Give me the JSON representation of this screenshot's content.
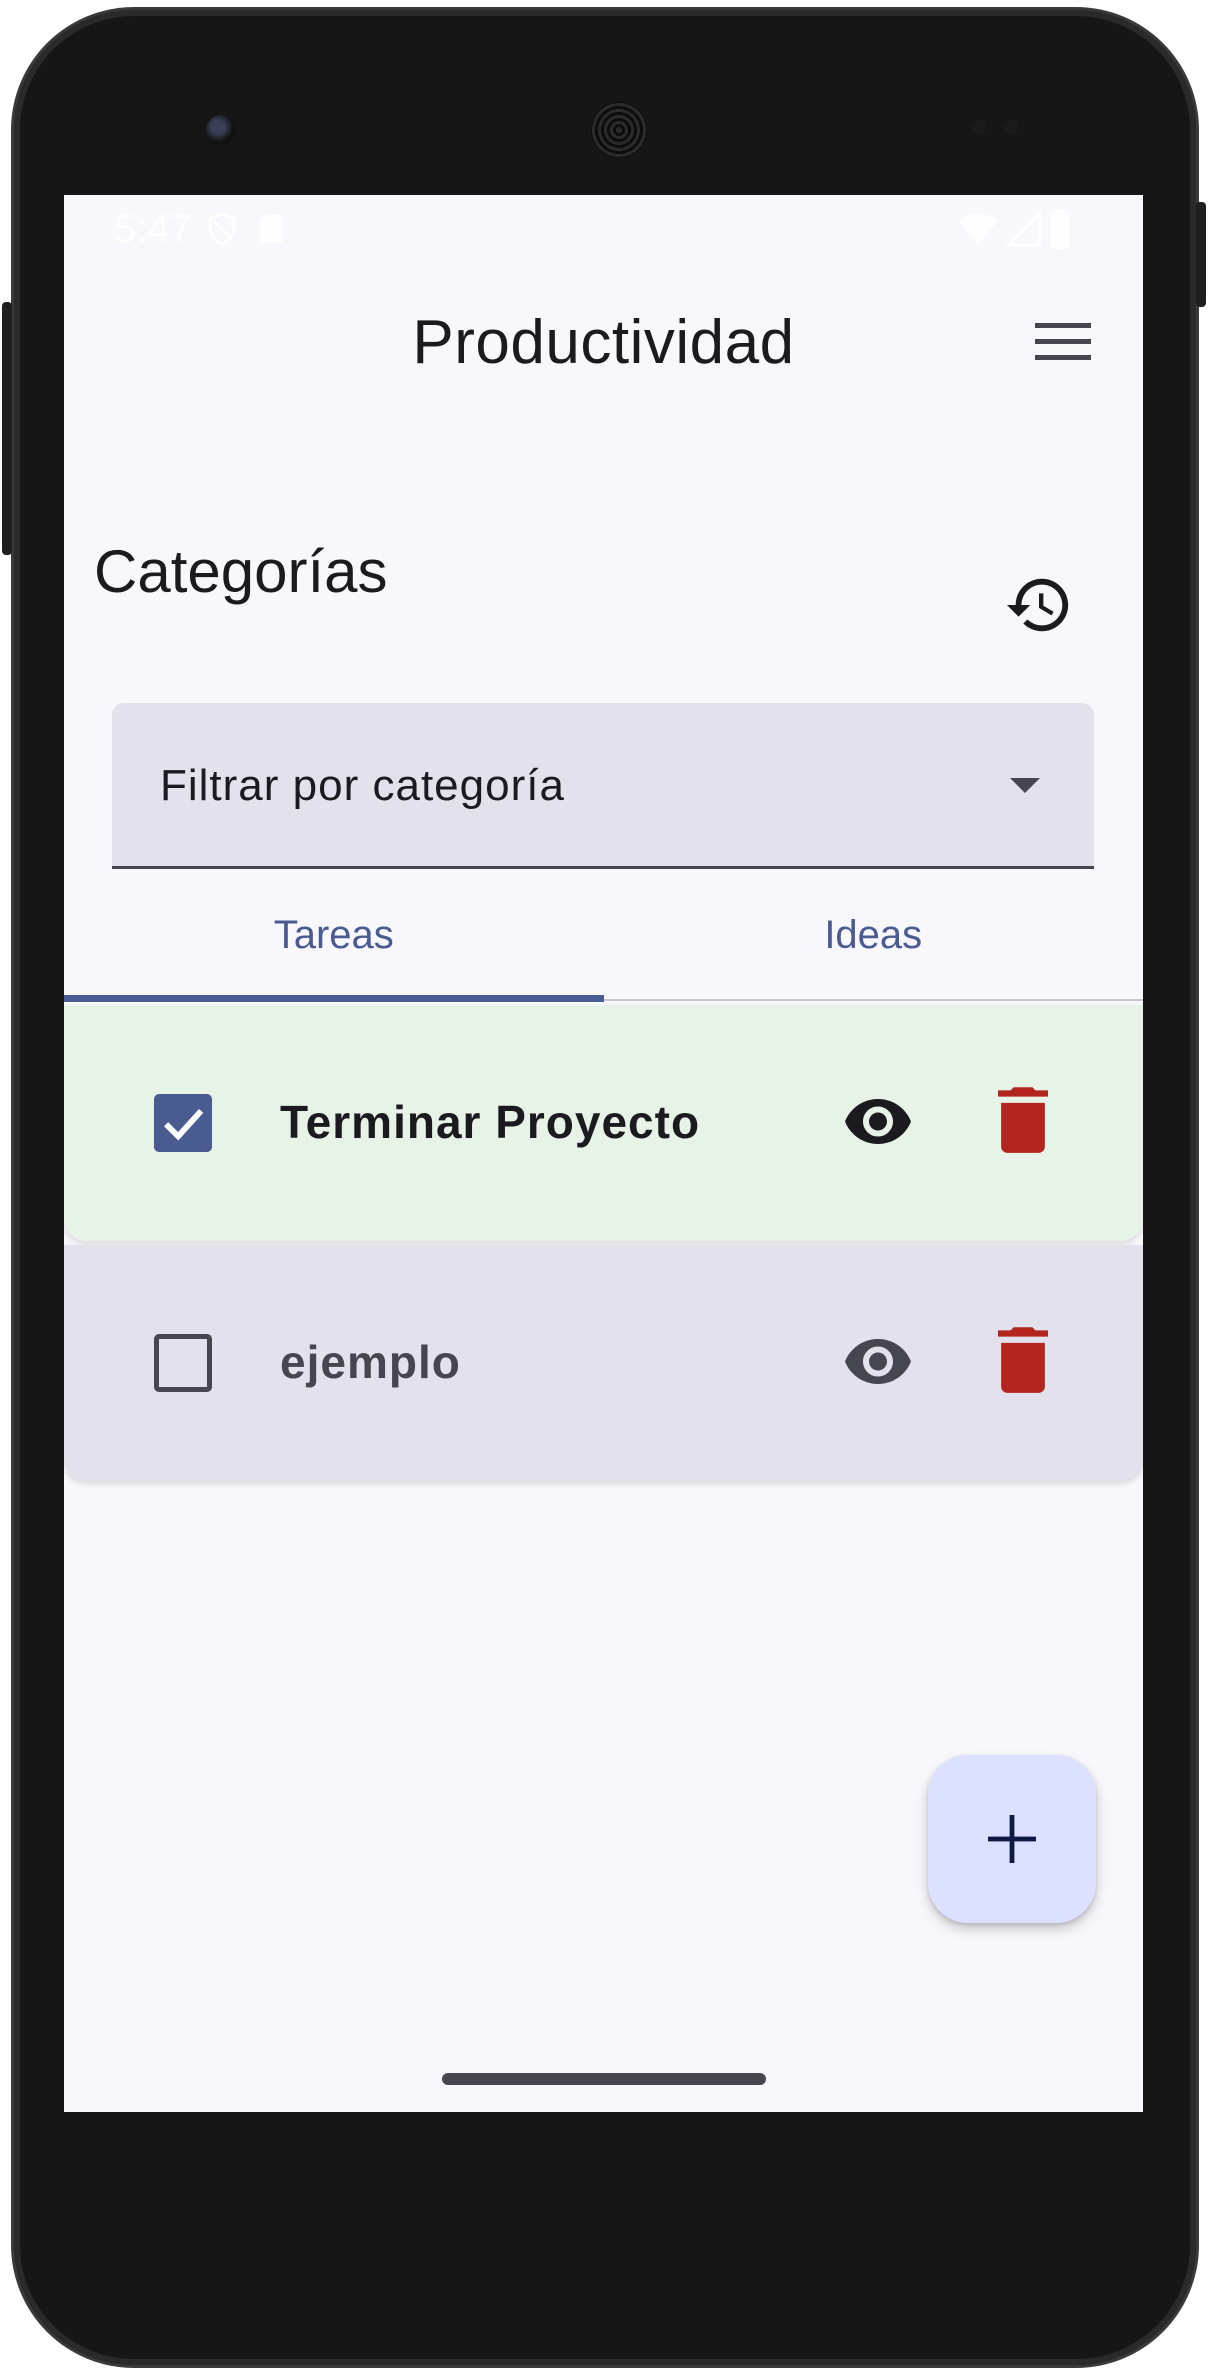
{
  "status_bar": {
    "time": "5:47",
    "left_icons": [
      "shield-icon",
      "sd-card-icon"
    ],
    "right_icons": [
      "wifi-icon",
      "signal-icon",
      "battery-icon"
    ]
  },
  "app_bar": {
    "title": "Productividad",
    "menu_icon": "menu-icon"
  },
  "section": {
    "title": "Categorías",
    "history_icon": "history-icon"
  },
  "filter": {
    "label": "Filtrar por categoría"
  },
  "tabs": [
    {
      "label": "Tareas",
      "selected": true
    },
    {
      "label": "Ideas",
      "selected": false
    }
  ],
  "tasks": [
    {
      "title": "Terminar Proyecto",
      "completed": true
    },
    {
      "title": "ejemplo",
      "completed": false
    }
  ],
  "fab": {
    "icon": "plus-icon"
  },
  "colors": {
    "primary": "#4a5b92",
    "background": "#f8f7fc",
    "completed_row": "#e6f3e6",
    "pending_row": "#e2e1ec",
    "delete": "#b3261e",
    "fab": "#dce1ff"
  }
}
